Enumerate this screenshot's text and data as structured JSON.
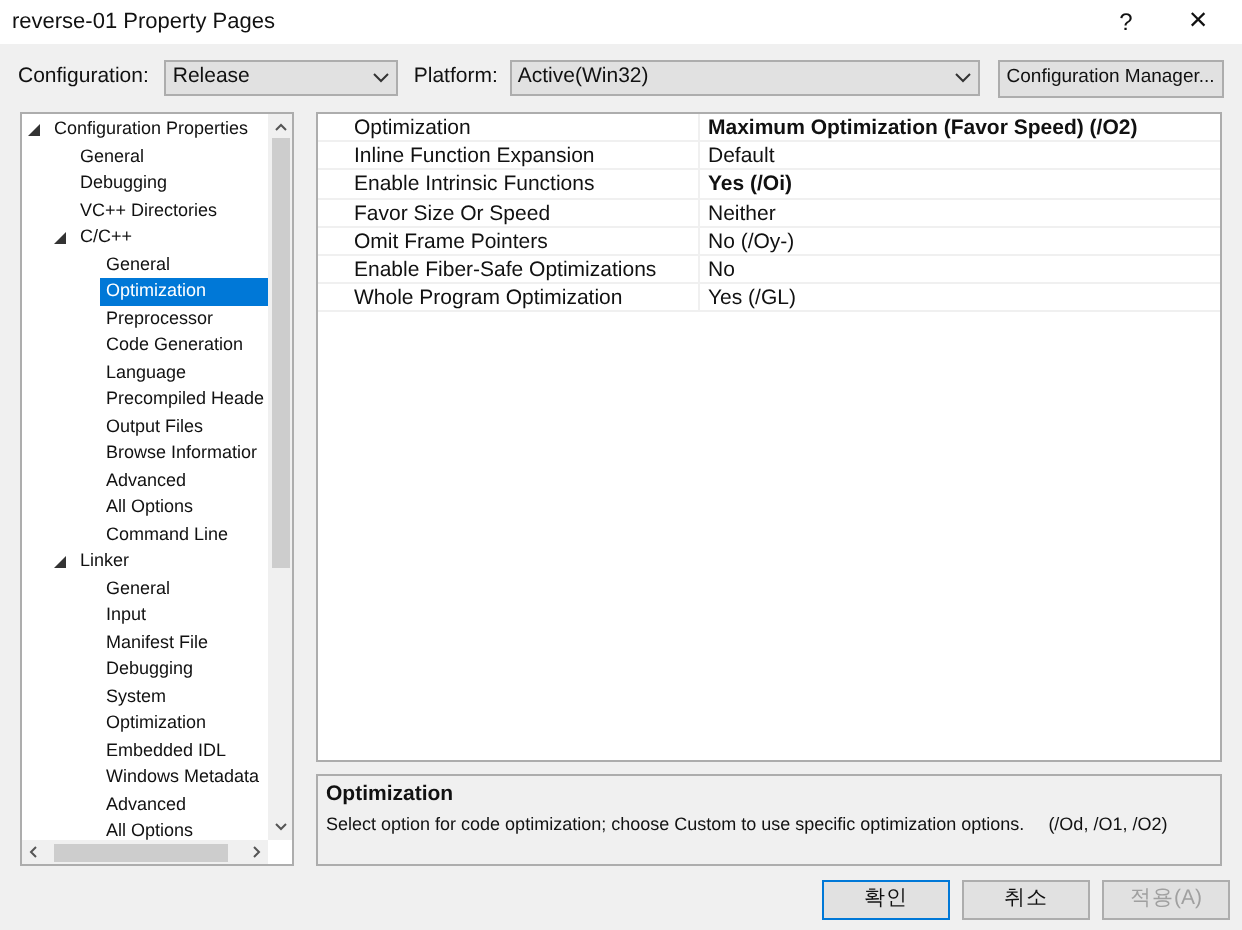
{
  "window": {
    "title": "reverse-01 Property Pages",
    "help": "?",
    "close": "×"
  },
  "configuration": {
    "label": "Configuration:",
    "value": "Release"
  },
  "platform": {
    "label": "Platform:",
    "value": "Active(Win32)"
  },
  "config_manager_button": "Configuration Manager...",
  "tree": [
    {
      "label": "Configuration Properties",
      "selected": false,
      "expanded": true,
      "children": [
        {
          "label": "General",
          "selected": false
        },
        {
          "label": "Debugging",
          "selected": false
        },
        {
          "label": "VC++ Directories",
          "selected": false
        },
        {
          "label": "C/C++",
          "selected": false,
          "expanded": true,
          "children": [
            {
              "label": "General",
              "selected": false
            },
            {
              "label": "Optimization",
              "selected": true
            },
            {
              "label": "Preprocessor",
              "selected": false
            },
            {
              "label": "Code Generation",
              "selected": false
            },
            {
              "label": "Language",
              "selected": false
            },
            {
              "label": "Precompiled Heade",
              "selected": false
            },
            {
              "label": "Output Files",
              "selected": false
            },
            {
              "label": "Browse Informatior",
              "selected": false
            },
            {
              "label": "Advanced",
              "selected": false
            },
            {
              "label": "All Options",
              "selected": false
            },
            {
              "label": "Command Line",
              "selected": false
            }
          ]
        },
        {
          "label": "Linker",
          "selected": false,
          "expanded": true,
          "children": [
            {
              "label": "General",
              "selected": false
            },
            {
              "label": "Input",
              "selected": false
            },
            {
              "label": "Manifest File",
              "selected": false
            },
            {
              "label": "Debugging",
              "selected": false
            },
            {
              "label": "System",
              "selected": false
            },
            {
              "label": "Optimization",
              "selected": false
            },
            {
              "label": "Embedded IDL",
              "selected": false
            },
            {
              "label": "Windows Metadata",
              "selected": false
            },
            {
              "label": "Advanced",
              "selected": false
            },
            {
              "label": "All Options",
              "selected": false
            }
          ]
        }
      ]
    }
  ],
  "properties": [
    {
      "name": "Optimization",
      "value": "Maximum Optimization (Favor Speed) (/O2)",
      "bold": true
    },
    {
      "name": "Inline Function Expansion",
      "value": "Default",
      "bold": false
    },
    {
      "name": "Enable Intrinsic Functions",
      "value": "Yes (/Oi)",
      "bold": true
    },
    {
      "name": "Favor Size Or Speed",
      "value": "Neither",
      "bold": false
    },
    {
      "name": "Omit Frame Pointers",
      "value": "No (/Oy-)",
      "bold": false
    },
    {
      "name": "Enable Fiber-Safe Optimizations",
      "value": "No",
      "bold": false
    },
    {
      "name": "Whole Program Optimization",
      "value": "Yes (/GL)",
      "bold": false
    }
  ],
  "description": {
    "title": "Optimization",
    "text": "Select option for code optimization; choose Custom to use specific optimization options.",
    "switches": "(/Od, /O1, /O2)"
  },
  "buttons": [
    {
      "label": "확인",
      "disabled": false,
      "default": true
    },
    {
      "label": "취소",
      "disabled": false,
      "default": false
    },
    {
      "label": "적용(A)",
      "disabled": true,
      "default": false
    }
  ]
}
